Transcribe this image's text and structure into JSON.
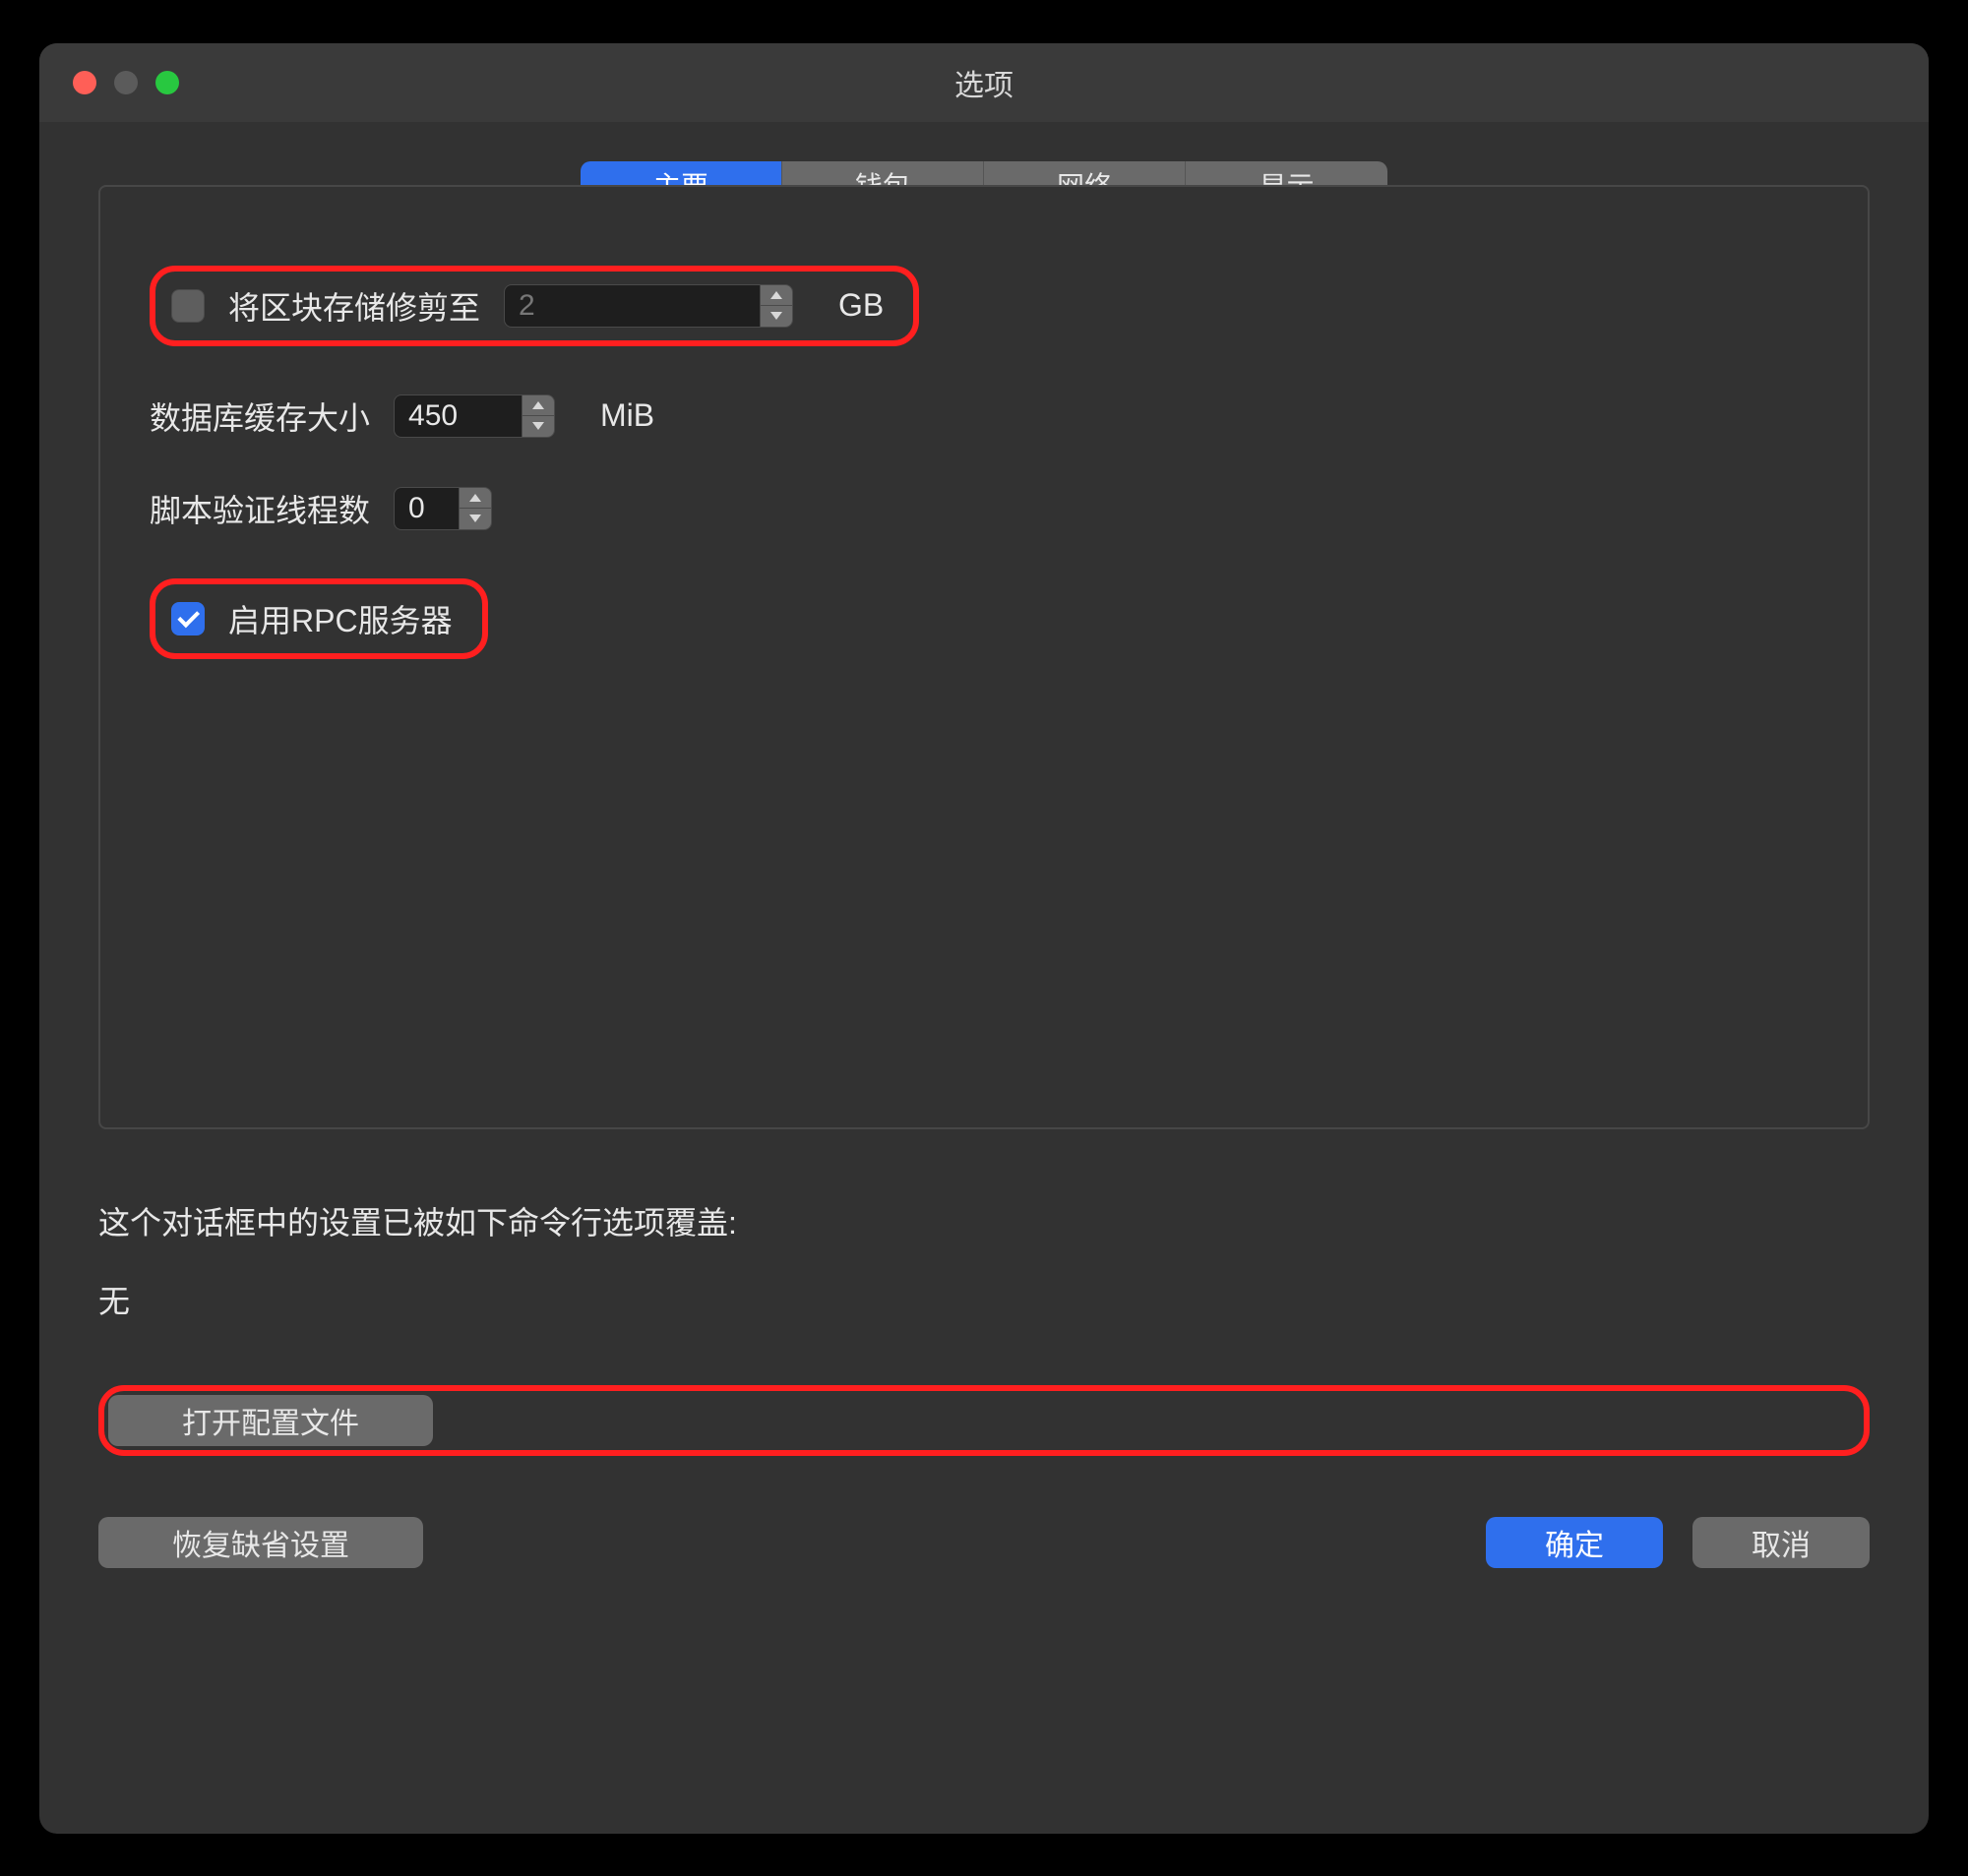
{
  "window": {
    "title": "选项"
  },
  "tabs": {
    "main": "主要",
    "wallet": "钱包",
    "network": "网络",
    "display": "显示"
  },
  "form": {
    "prune": {
      "label": "将区块存储修剪至",
      "value": "2",
      "unit": "GB",
      "checked": false
    },
    "dbcache": {
      "label": "数据库缓存大小",
      "value": "450",
      "unit": "MiB"
    },
    "threads": {
      "label": "脚本验证线程数",
      "value": "0"
    },
    "rpc": {
      "label": "启用RPC服务器",
      "checked": true
    }
  },
  "override_note": "这个对话框中的设置已被如下命令行选项覆盖:",
  "override_value": "无",
  "buttons": {
    "open_config": "打开配置文件",
    "reset": "恢复缺省设置",
    "ok": "确定",
    "cancel": "取消"
  }
}
